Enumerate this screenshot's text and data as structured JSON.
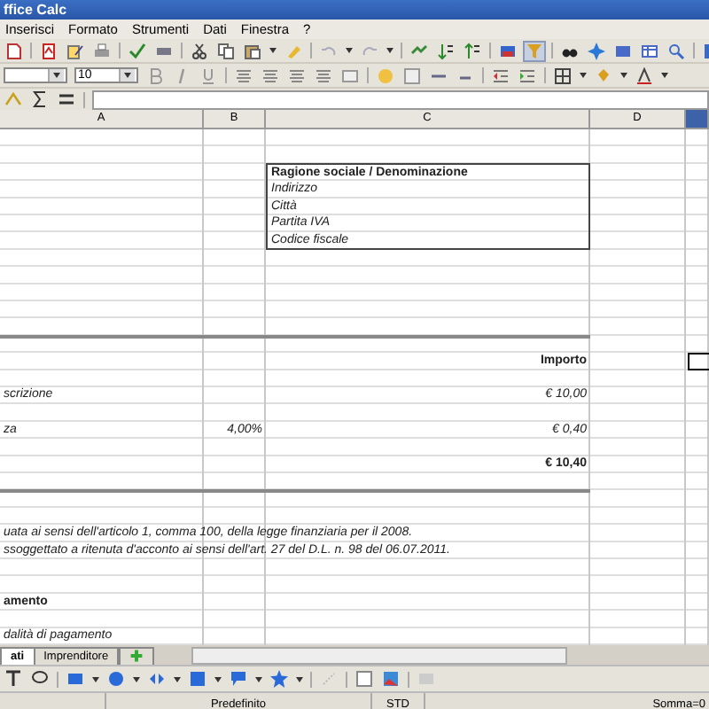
{
  "window": {
    "title": "ffice Calc"
  },
  "menu": [
    "Inserisci",
    "Formato",
    "Strumenti",
    "Dati",
    "Finestra",
    "?"
  ],
  "format_bar": {
    "font_size": "10"
  },
  "columns": [
    {
      "label": "A",
      "selected": false,
      "cells": [
        {
          "text": "scrizione",
          "kind": "field",
          "boxed": false
        },
        {
          "text": "za",
          "kind": "field",
          "boxed": false
        },
        {
          "text": "uata ai sensi dell'articolo 1, comma 100, della legge finanziaria per il 2008.",
          "kind": "note",
          "boxed": false
        },
        {
          "text": "ssoggettato a ritenuta d'acconto ai sensi dell'art. 27 del D.L. n. 98 del 06.07.2011.",
          "kind": "note",
          "boxed": false
        },
        {
          "text": "amento",
          "kind": "title",
          "boxed": false
        },
        {
          "text": "dalità di pagamento",
          "kind": "note",
          "boxed": false
        }
      ]
    },
    {
      "label": "B",
      "selected": false,
      "cells": [
        {
          "text": "4,00%",
          "kind": "amount",
          "boxed": false
        }
      ]
    },
    {
      "label": "C",
      "selected": false,
      "cells": [
        {
          "text": "Ragione sociale / Denominazione",
          "kind": "title",
          "boxed": true
        },
        {
          "text": "Indirizzo",
          "kind": "field",
          "boxed": true
        },
        {
          "text": "Città",
          "kind": "field",
          "boxed": true
        },
        {
          "text": "Partita IVA",
          "kind": "field",
          "boxed": true
        },
        {
          "text": "Codice fiscale",
          "kind": "field",
          "boxed": true
        },
        {
          "text": "Importo",
          "kind": "header",
          "boxed": false
        },
        {
          "text": "€ 10,00",
          "kind": "amount",
          "boxed": false
        },
        {
          "text": "€ 0,40",
          "kind": "amount",
          "boxed": false
        },
        {
          "text": "€ 10,40",
          "kind": "header",
          "boxed": false
        }
      ]
    },
    {
      "label": "D",
      "selected": false
    }
  ],
  "extra_column": {
    "selected": true
  },
  "sheet_tabs": [
    {
      "label": "ati",
      "selected": true
    },
    {
      "label": "Imprenditore",
      "selected": false
    }
  ],
  "status_bar": [
    "Predefinito",
    "STD",
    "Somma=0"
  ]
}
